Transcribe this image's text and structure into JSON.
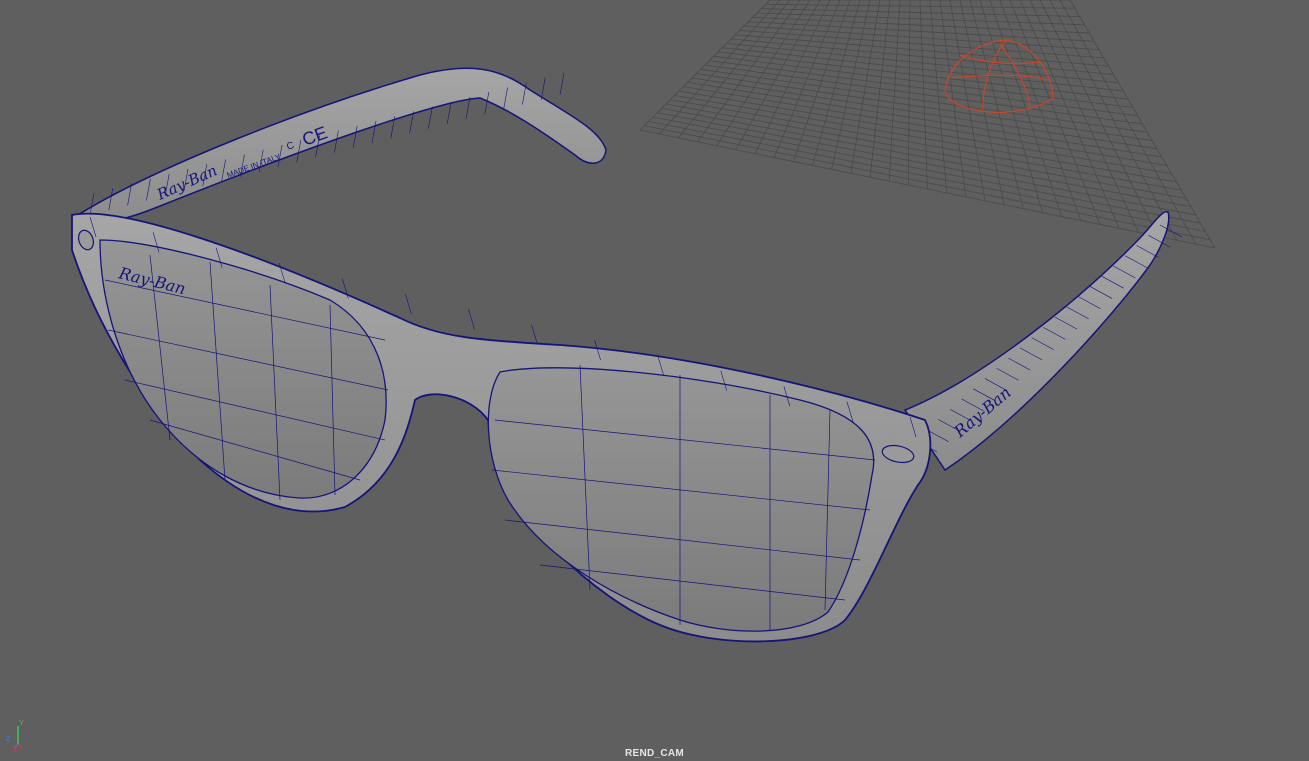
{
  "viewport": {
    "camera_name": "REND_CAM",
    "background_color": "#5f5f5f",
    "wire_color": "#14147a",
    "surface_color": "#8a8a8a",
    "grid_color": "#4a4a4a",
    "selection_color": "#c8462a"
  },
  "model": {
    "name": "sunglasses",
    "temple_text_left": [
      "Ray-Ban",
      "MADE IN ITALY",
      "C",
      "CE"
    ],
    "front_logo": "Ray-Ban",
    "temple_logo_right": "Ray-Ban"
  },
  "axis_gizmo": {
    "axes": [
      "X",
      "Y",
      "Z"
    ],
    "colors": {
      "x": "#d43c3c",
      "y": "#3cc85a",
      "z": "#3c78dc"
    }
  }
}
